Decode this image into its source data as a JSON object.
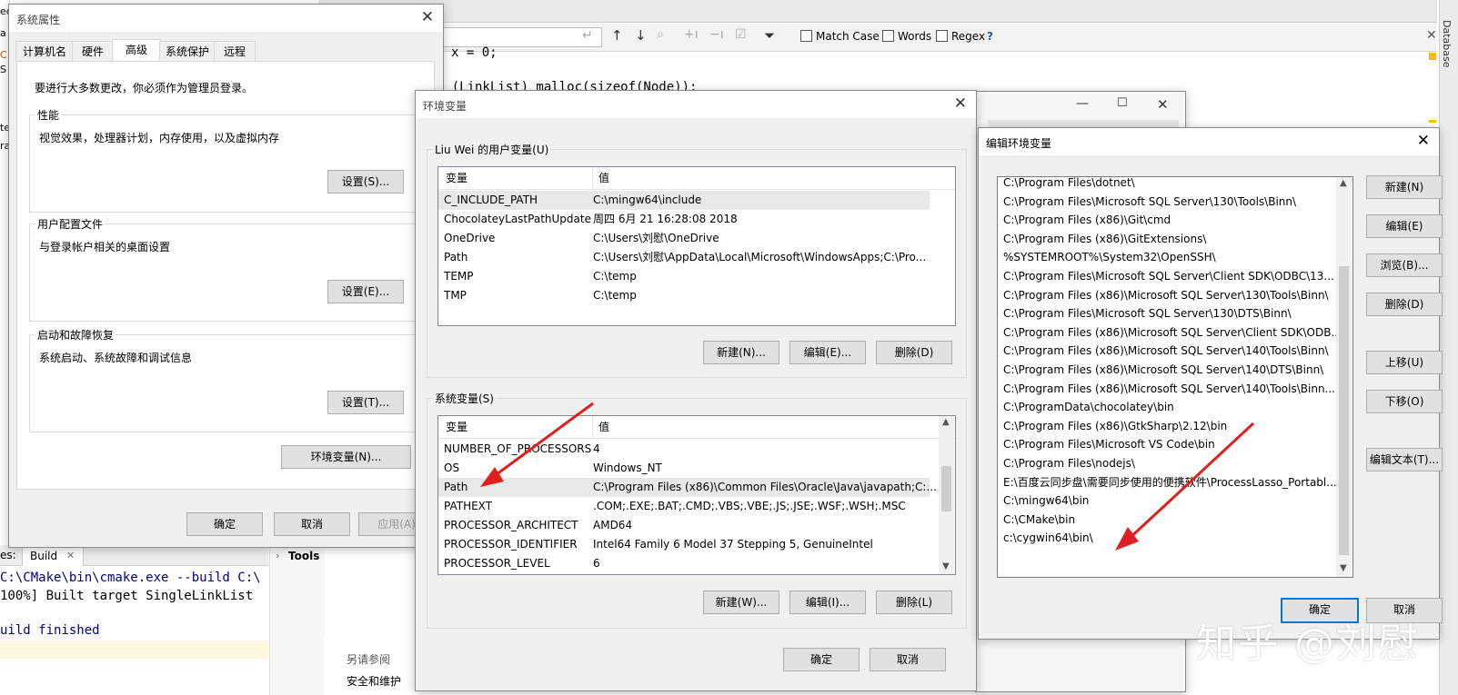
{
  "ide": {
    "search_labels": {
      "match_case": "Match Case",
      "words": "Words",
      "regex": "Regex",
      "help": "?"
    },
    "code_lines": [
      "x = 0;",
      "d = (LinkList) malloc(sizeof(Node));"
    ],
    "side_label": "Database",
    "build_tab_prefix": "es:",
    "build_tab": "Build",
    "build_output": [
      "C:\\CMake\\bin\\cmake.exe --build C:\\",
      "100%] Built target SingleLinkList",
      "uild finished"
    ],
    "tools_label": "Tools",
    "left_edge_chars": [
      "ed",
      "a",
      "C",
      "S",
      "te",
      "ra"
    ],
    "see_also": "另请参阅",
    "security": "安全和维护"
  },
  "sysprops": {
    "title": "系统属性",
    "tabs": [
      "计算机名",
      "硬件",
      "高级",
      "系统保护",
      "远程"
    ],
    "active_tab": 2,
    "admin_note": "要进行大多数更改，你必须作为管理员登录。",
    "groups": [
      {
        "label": "性能",
        "text": "视觉效果，处理器计划，内存使用，以及虚拟内存",
        "button": "设置(S)..."
      },
      {
        "label": "用户配置文件",
        "text": "与登录帐户相关的桌面设置",
        "button": "设置(E)..."
      },
      {
        "label": "启动和故障恢复",
        "text": "系统启动、系统故障和调试信息",
        "button": "设置(T)..."
      }
    ],
    "env_button": "环境变量(N)...",
    "ok": "确定",
    "cancel": "取消",
    "apply": "应用(A)"
  },
  "envvars": {
    "title": "环境变量",
    "user_group": "Liu Wei 的用户变量(U)",
    "col_var": "变量",
    "col_val": "值",
    "user_vars": [
      {
        "name": "C_INCLUDE_PATH",
        "value": "C:\\mingw64\\include"
      },
      {
        "name": "ChocolateyLastPathUpdate",
        "value": "周四 6月 21 16:28:08 2018"
      },
      {
        "name": "OneDrive",
        "value": "C:\\Users\\刘慰\\OneDrive"
      },
      {
        "name": "Path",
        "value": "C:\\Users\\刘慰\\AppData\\Local\\Microsoft\\WindowsApps;C:\\Pro..."
      },
      {
        "name": "TEMP",
        "value": "C:\\temp"
      },
      {
        "name": "TMP",
        "value": "C:\\temp"
      }
    ],
    "user_buttons": [
      "新建(N)...",
      "编辑(E)...",
      "删除(D)"
    ],
    "sys_group": "系统变量(S)",
    "sys_vars": [
      {
        "name": "NUMBER_OF_PROCESSORS",
        "value": "4"
      },
      {
        "name": "OS",
        "value": "Windows_NT"
      },
      {
        "name": "Path",
        "value": "C:\\Program Files (x86)\\Common Files\\Oracle\\Java\\javapath;C:..."
      },
      {
        "name": "PATHEXT",
        "value": ".COM;.EXE;.BAT;.CMD;.VBS;.VBE;.JS;.JSE;.WSF;.WSH;.MSC"
      },
      {
        "name": "PROCESSOR_ARCHITECT",
        "value": "AMD64"
      },
      {
        "name": "PROCESSOR_IDENTIFIER",
        "value": "Intel64 Family 6 Model 37 Stepping 5, GenuineIntel"
      },
      {
        "name": "PROCESSOR_LEVEL",
        "value": "6"
      }
    ],
    "sys_buttons": [
      "新建(W)...",
      "编辑(I)...",
      "删除(L)"
    ],
    "ok": "确定",
    "cancel": "取消"
  },
  "editenv": {
    "title": "编辑环境变量",
    "entries": [
      "C:\\Program Files\\dotnet\\",
      "C:\\Program Files\\Microsoft SQL Server\\130\\Tools\\Binn\\",
      "C:\\Program Files (x86)\\Git\\cmd",
      "C:\\Program Files (x86)\\GitExtensions\\",
      "%SYSTEMROOT%\\System32\\OpenSSH\\",
      "C:\\Program Files\\Microsoft SQL Server\\Client SDK\\ODBC\\13...",
      "C:\\Program Files (x86)\\Microsoft SQL Server\\130\\Tools\\Binn\\",
      "C:\\Program Files\\Microsoft SQL Server\\130\\DTS\\Binn\\",
      "C:\\Program Files (x86)\\Microsoft SQL Server\\Client SDK\\ODB...",
      "C:\\Program Files (x86)\\Microsoft SQL Server\\140\\Tools\\Binn\\",
      "C:\\Program Files (x86)\\Microsoft SQL Server\\140\\DTS\\Binn\\",
      "C:\\Program Files (x86)\\Microsoft SQL Server\\140\\Tools\\Binn...",
      "C:\\ProgramData\\chocolatey\\bin",
      "C:\\Program Files (x86)\\GtkSharp\\2.12\\bin",
      "C:\\Program Files\\Microsoft VS Code\\bin",
      "C:\\Program Files\\nodejs\\",
      "E:\\百度云同步盘\\需要同步使用的便携软件\\ProcessLasso_Portabl...",
      "C:\\mingw64\\bin",
      "C:\\CMake\\bin",
      "c:\\cygwin64\\bin\\"
    ],
    "buttons": [
      "新建(N)",
      "编辑(E)",
      "浏览(B)...",
      "删除(D)",
      "上移(U)",
      "下移(O)",
      "编辑文本(T)..."
    ],
    "ok": "确定",
    "cancel": "取消"
  },
  "watermark": "知乎 @刘慰"
}
